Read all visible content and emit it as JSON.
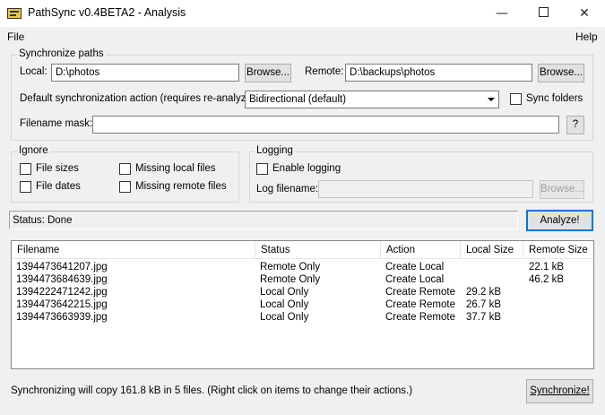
{
  "window": {
    "title": "PathSync v0.4BETA2 - Analysis",
    "minimize_glyph": "—",
    "close_glyph": "✕"
  },
  "menu": {
    "file": "File",
    "help": "Help"
  },
  "sync_paths": {
    "group_title": "Synchronize paths",
    "local_label": "Local:",
    "local_value": "D:\\photos",
    "local_browse": "Browse...",
    "remote_label": "Remote:",
    "remote_value": "D:\\backups\\photos",
    "remote_browse": "Browse...",
    "default_action_label": "Default synchronization action (requires re-analyze):",
    "default_action_value": "Bidirectional (default)",
    "sync_folders_label": "Sync folders",
    "sync_folders_checked": false,
    "filename_mask_label": "Filename mask:",
    "filename_mask_value": "",
    "mask_help_button": "?"
  },
  "ignore": {
    "group_title": "Ignore",
    "file_sizes": "File sizes",
    "file_dates": "File dates",
    "missing_local": "Missing local files",
    "missing_remote": "Missing remote files"
  },
  "logging": {
    "group_title": "Logging",
    "enable_label": "Enable logging",
    "log_filename_label": "Log filename:",
    "log_filename_value": "",
    "browse_label": "Browse..."
  },
  "status": {
    "text": "Status: Done",
    "analyze_button": "Analyze!"
  },
  "file_list": {
    "columns": [
      "Filename",
      "Status",
      "Action",
      "Local Size",
      "Remote Size"
    ],
    "rows": [
      [
        "1394473641207.jpg",
        "Remote Only",
        "Create Local",
        "",
        "22.1 kB"
      ],
      [
        "1394473684639.jpg",
        "Remote Only",
        "Create Local",
        "",
        "46.2 kB"
      ],
      [
        "1394222471242.jpg",
        "Local Only",
        "Create Remote",
        "29.2 kB",
        ""
      ],
      [
        "1394473642215.jpg",
        "Local Only",
        "Create Remote",
        "26.7 kB",
        ""
      ],
      [
        "1394473663939.jpg",
        "Local Only",
        "Create Remote",
        "37.7 kB",
        ""
      ]
    ]
  },
  "footer": {
    "summary": "Synchronizing will copy 161.8 kB in 5 files. (Right click on items to change their actions.)",
    "synchronize_button": "Synchronize!"
  }
}
